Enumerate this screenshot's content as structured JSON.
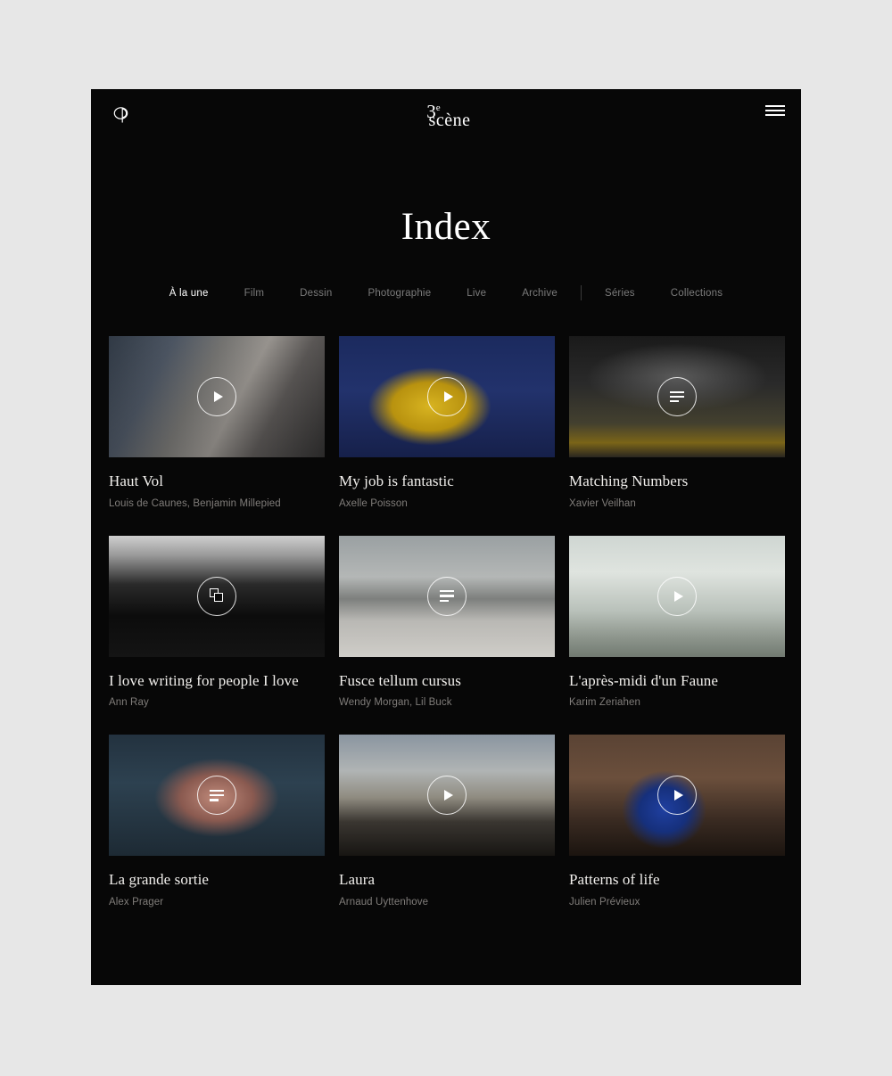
{
  "header": {
    "op_logo_name": "opera-de-paris-monogram",
    "brand_top": "3",
    "brand_sup": "e",
    "brand_bottom": "scène",
    "menu_label": "menu"
  },
  "page": {
    "title": "Index"
  },
  "nav": {
    "items": [
      {
        "label": "À la une",
        "active": true
      },
      {
        "label": "Film",
        "active": false
      },
      {
        "label": "Dessin",
        "active": false
      },
      {
        "label": "Photographie",
        "active": false
      },
      {
        "label": "Live",
        "active": false
      },
      {
        "label": "Archive",
        "active": false
      }
    ],
    "items_secondary": [
      {
        "label": "Séries",
        "active": false
      },
      {
        "label": "Collections",
        "active": false
      }
    ]
  },
  "grid": {
    "cards": [
      {
        "title": "Haut Vol",
        "credit": "Louis de Caunes, Benjamin Millepied",
        "icon": "play-icon",
        "art": "art-hautvol"
      },
      {
        "title": "My job is fantastic",
        "credit": "Axelle Poisson",
        "icon": "play-icon",
        "art": "art-myjob"
      },
      {
        "title": "Matching Numbers",
        "credit": "Xavier Veilhan",
        "icon": "text-icon",
        "art": "art-matching"
      },
      {
        "title": "I love writing for people I love",
        "credit": "Ann Ray",
        "icon": "gallery-icon",
        "art": "art-ilove"
      },
      {
        "title": "Fusce tellum cursus",
        "credit": "Wendy Morgan, Lil Buck",
        "icon": "text-icon",
        "art": "art-fusce"
      },
      {
        "title": "L'après-midi d'un Faune",
        "credit": "Karim Zeriahen",
        "icon": "play-icon",
        "art": "art-faune"
      },
      {
        "title": "La grande sortie",
        "credit": "Alex Prager",
        "icon": "text-icon",
        "art": "art-grande"
      },
      {
        "title": "Laura",
        "credit": "Arnaud Uyttenhove",
        "icon": "play-icon",
        "art": "art-laura"
      },
      {
        "title": "Patterns of life",
        "credit": "Julien Prévieux",
        "icon": "play-icon",
        "art": "art-patterns"
      }
    ]
  },
  "colors": {
    "app_background": "#070707",
    "page_background": "#e7e7e7",
    "text_primary": "#f2f0ed",
    "text_muted": "#807d7a",
    "nav_inactive": "#7b7b7b"
  }
}
